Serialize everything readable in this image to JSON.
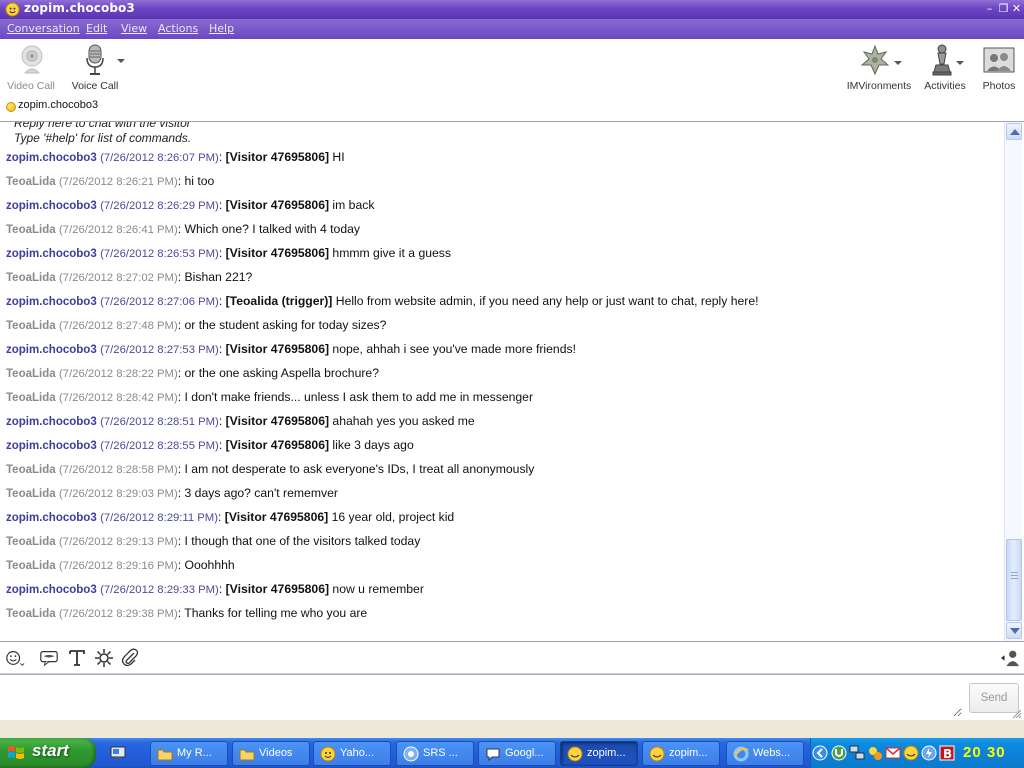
{
  "window": {
    "title": "zopim.chocobo3",
    "controls": [
      "minimize",
      "restore",
      "close"
    ]
  },
  "menu": [
    "Conversation",
    "Edit",
    "View",
    "Actions",
    "Help"
  ],
  "toolbar": {
    "video_call": "Video Call",
    "voice_call": "Voice Call",
    "imvironments": "IMVironments",
    "activities": "Activities",
    "photos": "Photos"
  },
  "contact": {
    "name": "zopim.chocobo3",
    "status_color": "#f1b400"
  },
  "system_message": {
    "line1": "Reply here to chat with the visitor",
    "line2": "Type '#help' for list of commands."
  },
  "messages": [
    {
      "role": "agent",
      "sender": "zopim.chocobo3",
      "time": "(7/26/2012 8:26:07 PM)",
      "tag": "[Visitor 47695806]",
      "text": " HI"
    },
    {
      "role": "visitor",
      "sender": "TeoaLida",
      "time": "(7/26/2012 8:26:21 PM)",
      "tag": "",
      "text": "hi too"
    },
    {
      "role": "agent",
      "sender": "zopim.chocobo3",
      "time": "(7/26/2012 8:26:29 PM)",
      "tag": "[Visitor 47695806]",
      "text": " im back"
    },
    {
      "role": "visitor",
      "sender": "TeoaLida",
      "time": "(7/26/2012 8:26:41 PM)",
      "tag": "",
      "text": "Which one? I talked with 4 today"
    },
    {
      "role": "agent",
      "sender": "zopim.chocobo3",
      "time": "(7/26/2012 8:26:53 PM)",
      "tag": "[Visitor 47695806]",
      "text": " hmmm give it a guess"
    },
    {
      "role": "visitor",
      "sender": "TeoaLida",
      "time": "(7/26/2012 8:27:02 PM)",
      "tag": "",
      "text": "Bishan 221?"
    },
    {
      "role": "agent",
      "sender": "zopim.chocobo3",
      "time": "(7/26/2012 8:27:06 PM)",
      "tag": "[Teoalida (trigger)]",
      "text": " Hello from website admin, if you need any help or just want to chat, reply here!"
    },
    {
      "role": "visitor",
      "sender": "TeoaLida",
      "time": "(7/26/2012 8:27:48 PM)",
      "tag": "",
      "text": "or the student asking for today sizes?"
    },
    {
      "role": "agent",
      "sender": "zopim.chocobo3",
      "time": "(7/26/2012 8:27:53 PM)",
      "tag": "[Visitor 47695806]",
      "text": " nope, ahhah i see you've made more friends!"
    },
    {
      "role": "visitor",
      "sender": "TeoaLida",
      "time": "(7/26/2012 8:28:22 PM)",
      "tag": "",
      "text": "or the one asking Aspella brochure?"
    },
    {
      "role": "visitor",
      "sender": "TeoaLida",
      "time": "(7/26/2012 8:28:42 PM)",
      "tag": "",
      "text": "I don't make friends... unless I ask them to add me in messenger"
    },
    {
      "role": "agent",
      "sender": "zopim.chocobo3",
      "time": "(7/26/2012 8:28:51 PM)",
      "tag": "[Visitor 47695806]",
      "text": " ahahah yes you asked me"
    },
    {
      "role": "agent",
      "sender": "zopim.chocobo3",
      "time": "(7/26/2012 8:28:55 PM)",
      "tag": "[Visitor 47695806]",
      "text": " like 3 days ago"
    },
    {
      "role": "visitor",
      "sender": "TeoaLida",
      "time": "(7/26/2012 8:28:58 PM)",
      "tag": "",
      "text": "I am not desperate to ask everyone's IDs, I treat all anonymously"
    },
    {
      "role": "visitor",
      "sender": "TeoaLida",
      "time": "(7/26/2012 8:29:03 PM)",
      "tag": "",
      "text": "3 days ago? can't rememver"
    },
    {
      "role": "agent",
      "sender": "zopim.chocobo3",
      "time": "(7/26/2012 8:29:11 PM)",
      "tag": "[Visitor 47695806]",
      "text": " 16 year old, project kid"
    },
    {
      "role": "visitor",
      "sender": "TeoaLida",
      "time": "(7/26/2012 8:29:13 PM)",
      "tag": "",
      "text": "I though that one of the visitors talked today"
    },
    {
      "role": "visitor",
      "sender": "TeoaLida",
      "time": "(7/26/2012 8:29:16 PM)",
      "tag": "",
      "text": "Ooohhhh"
    },
    {
      "role": "agent",
      "sender": "zopim.chocobo3",
      "time": "(7/26/2012 8:29:33 PM)",
      "tag": "[Visitor 47695806]",
      "text": " now u remember"
    },
    {
      "role": "visitor",
      "sender": "TeoaLida",
      "time": "(7/26/2012 8:29:38 PM)",
      "tag": "",
      "text": "Thanks for telling me who you are"
    }
  ],
  "scroll": {
    "position": 1.0,
    "visible_fraction": 0.17
  },
  "format_bar": [
    "emoticon-icon",
    "im-environment-icon",
    "text-format-icon",
    "plugin-icon",
    "attach-icon",
    "contact-icon"
  ],
  "input": {
    "value": "",
    "placeholder": ""
  },
  "send_label": "Send",
  "taskbar": {
    "start_label": "start",
    "tasks": [
      {
        "label": "My R...",
        "icon": "folder-icon",
        "active": false
      },
      {
        "label": "Videos",
        "icon": "folder-icon",
        "active": false
      },
      {
        "label": "Yaho...",
        "icon": "yahoo-icon",
        "active": false
      },
      {
        "label": "SRS ...",
        "icon": "browser-icon",
        "active": false
      },
      {
        "label": "Googl...",
        "icon": "gtalk-icon",
        "active": false
      },
      {
        "label": "zopim...",
        "icon": "messenger-icon",
        "active": true
      },
      {
        "label": "zopim...",
        "icon": "messenger-icon",
        "active": false
      },
      {
        "label": "Webs...",
        "icon": "ie-icon",
        "active": false
      }
    ],
    "clock": "20 30"
  }
}
